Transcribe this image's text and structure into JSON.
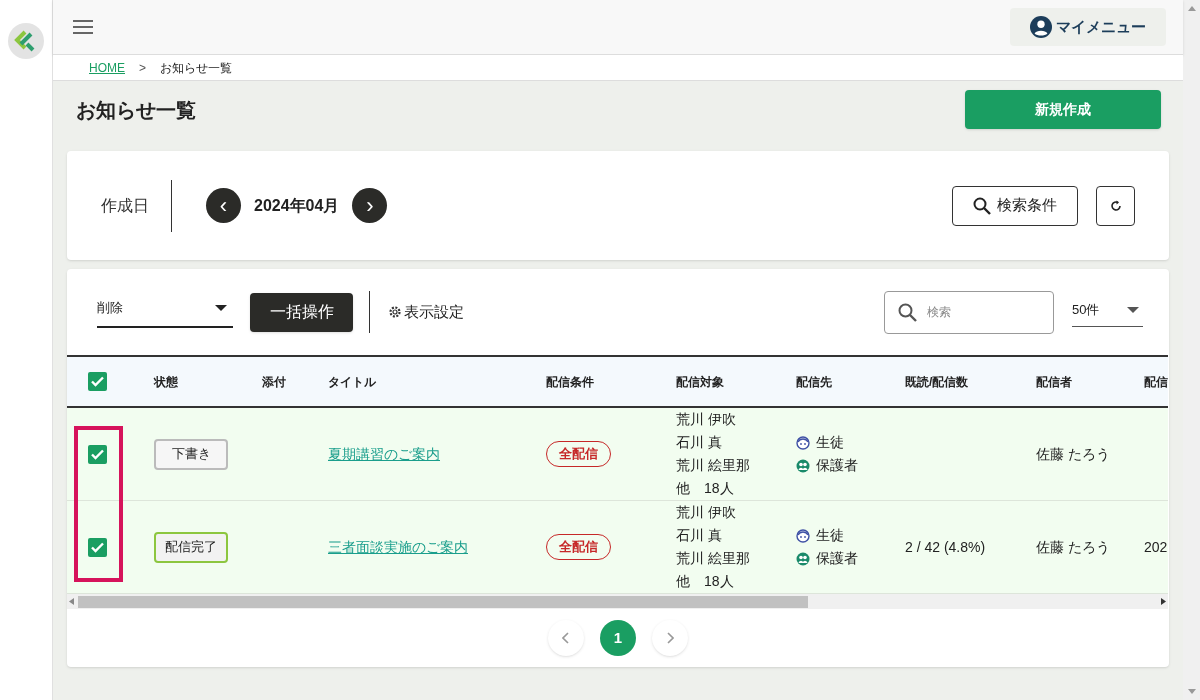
{
  "header": {
    "my_menu": "マイメニュー"
  },
  "breadcrumb": [
    {
      "label": "HOME",
      "kind": "link"
    },
    {
      "label": ">",
      "kind": "separator"
    },
    {
      "label": "お知らせ一覧",
      "kind": "current"
    }
  ],
  "page_title": "お知らせ一覧",
  "new_button": "新規作成",
  "filter": {
    "label": "作成日",
    "prev": "‹",
    "month": "2024年04月",
    "next": "›",
    "search_conditions": "検索条件"
  },
  "toolbar": {
    "action_select": "削除",
    "bulk_button": "一括操作",
    "display_settings": "表示設定",
    "search_placeholder": "検索",
    "page_size": "50件"
  },
  "table": {
    "all_checked": true,
    "columns": [
      "状態",
      "添付",
      "タイトル",
      "配信条件",
      "配信対象",
      "配信先",
      "既読/配信数",
      "配信者",
      "配信"
    ],
    "rows": [
      {
        "checked": true,
        "status": "下書き",
        "kind": "draft",
        "title": "夏期講習のご案内",
        "condition": "全配信",
        "targets": [
          "荒川 伊吹",
          "石川 真",
          "荒川 絵里那",
          "他　18人"
        ],
        "destinations": [
          {
            "kind": "student",
            "label": "生徒"
          },
          {
            "kind": "guardian",
            "label": "保護者"
          }
        ],
        "sender": "佐藤 たろう"
      },
      {
        "checked": true,
        "status": "配信完了",
        "kind": "done",
        "title": "三者面談実施のご案内",
        "condition": "全配信",
        "targets": [
          "荒川 伊吹",
          "石川 真",
          "荒川 絵里那",
          "他　18人"
        ],
        "destinations": [
          {
            "kind": "student",
            "label": "生徒"
          },
          {
            "kind": "guardian",
            "label": "保護者"
          }
        ],
        "read_count": "2 / 42 (4.8%)",
        "sender": "佐藤 たろう",
        "date": "202"
      }
    ]
  },
  "pagination": {
    "pages": [
      {
        "label": "1",
        "selected": true
      }
    ]
  }
}
